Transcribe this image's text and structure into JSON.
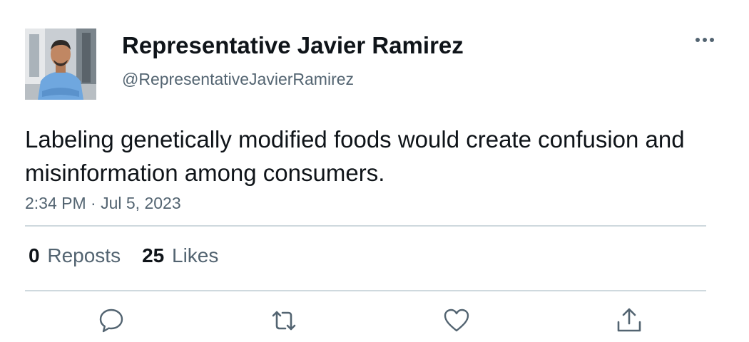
{
  "author": {
    "display_name": "Representative Javier Ramirez",
    "handle": "@RepresentativeJavierRamirez",
    "avatar_icon": "profile-photo"
  },
  "tweet": {
    "text": "Labeling genetically modified foods would create confusion and misinformation among consumers.",
    "timestamp": "2:34 PM · Jul 5, 2023"
  },
  "stats": {
    "reposts_count": "0",
    "reposts_label": "Reposts",
    "likes_count": "25",
    "likes_label": "Likes"
  },
  "actions": [
    {
      "icon": "reply-icon"
    },
    {
      "icon": "repost-icon"
    },
    {
      "icon": "like-icon"
    },
    {
      "icon": "share-icon"
    }
  ],
  "colors": {
    "text_primary": "#0f1419",
    "text_secondary": "#536471",
    "divider": "#cfd9de",
    "icon": "#536471"
  }
}
